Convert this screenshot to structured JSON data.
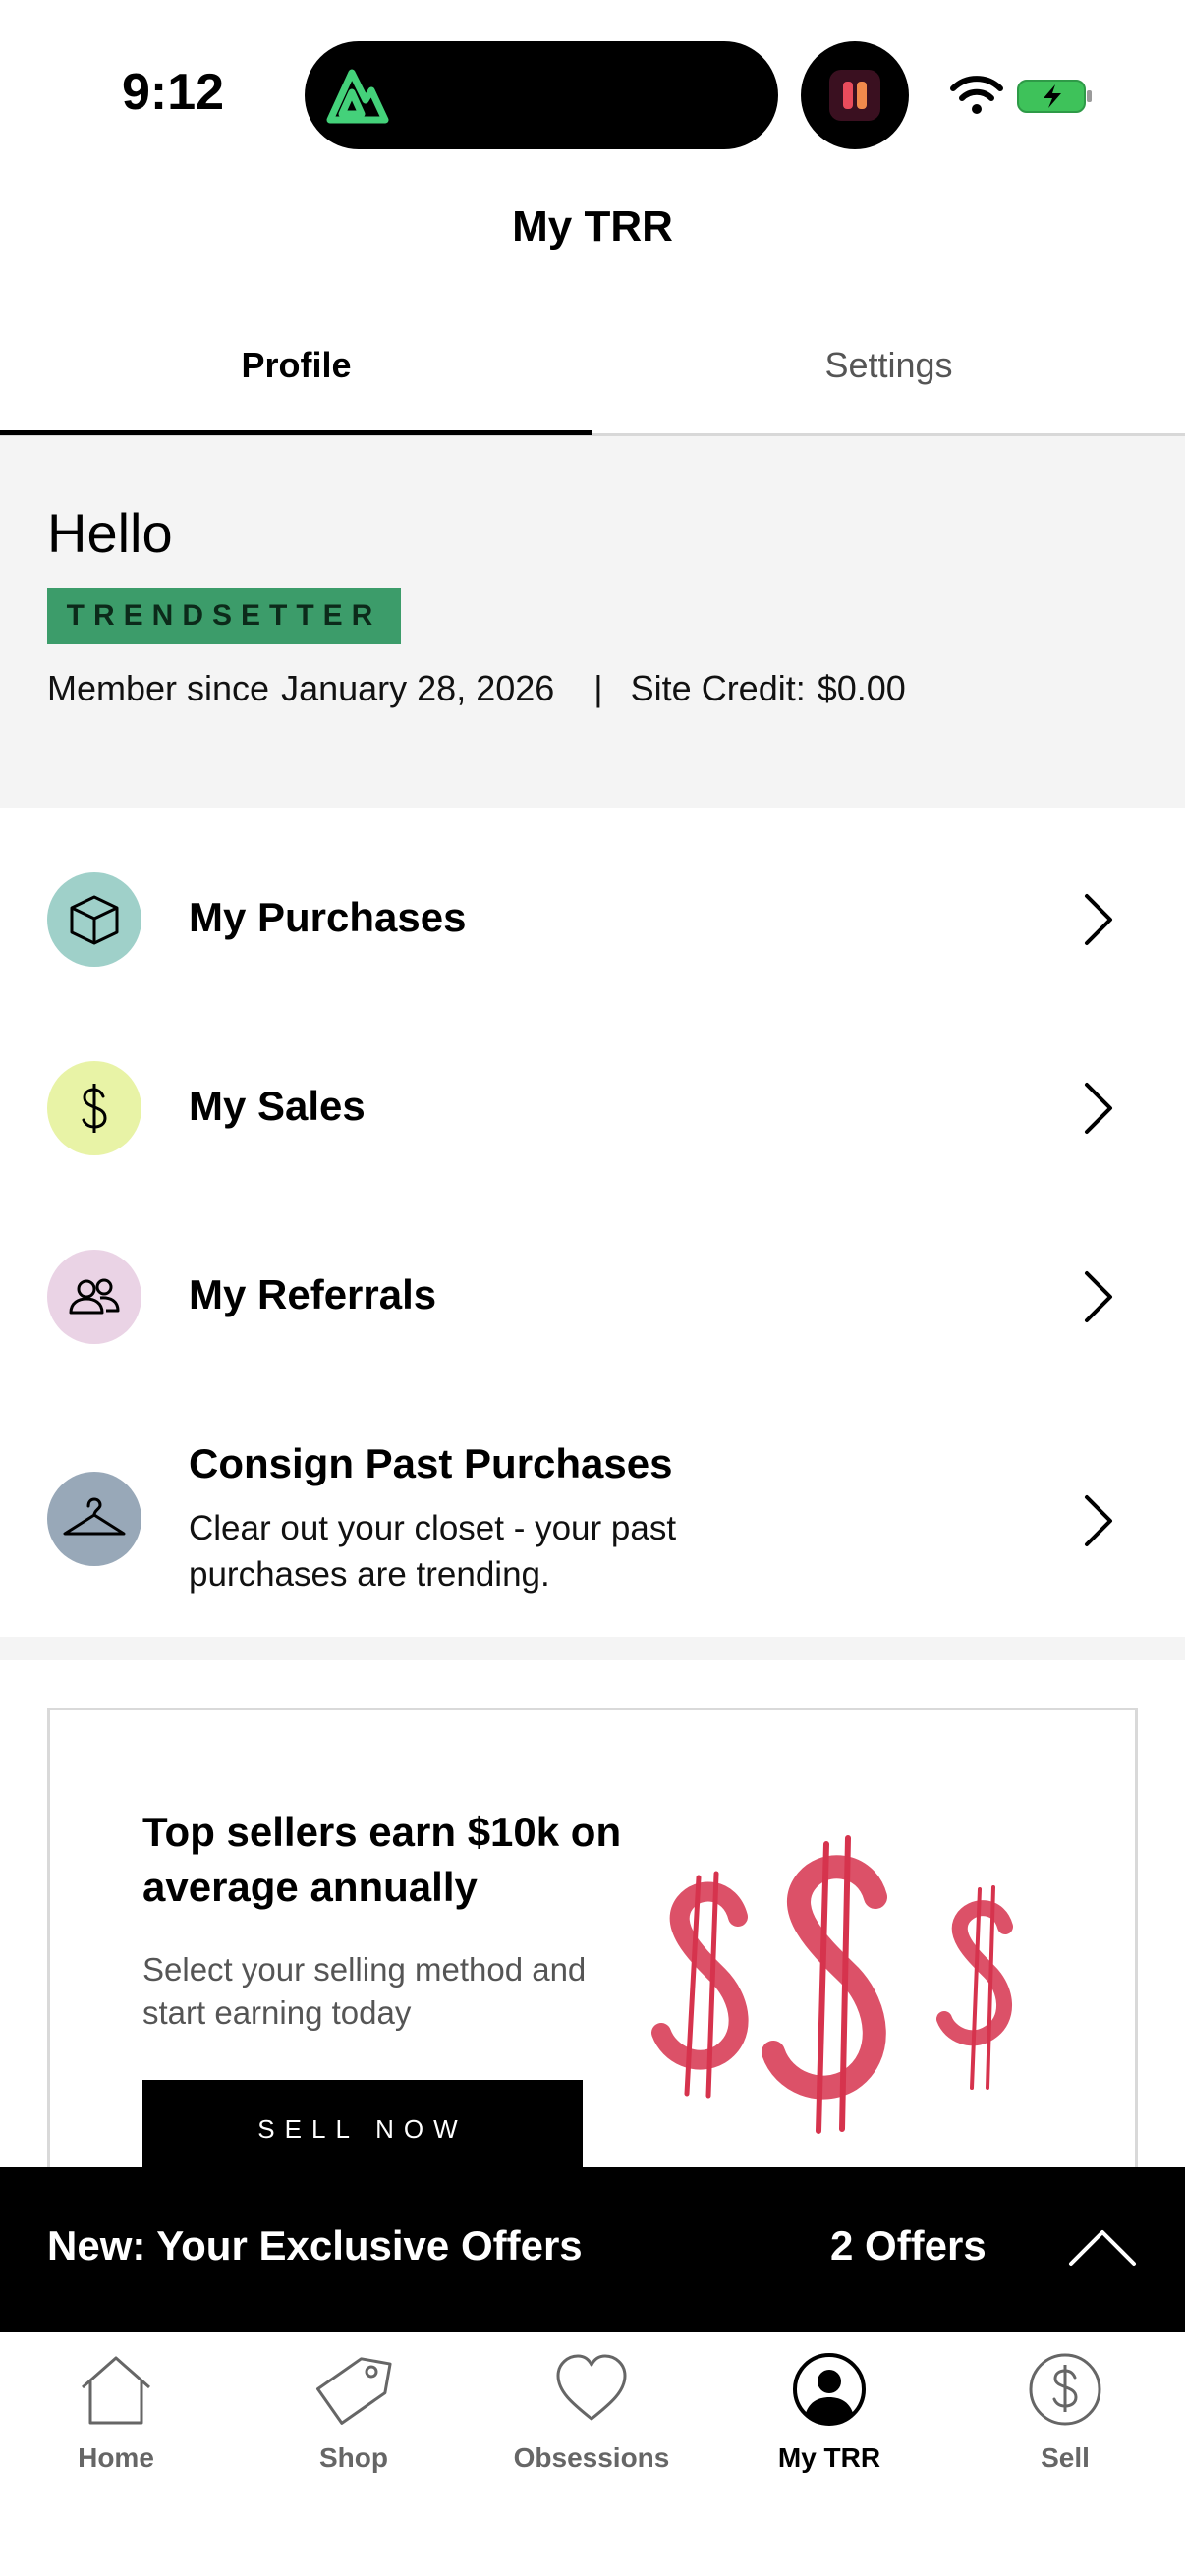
{
  "status_bar": {
    "time": "9:12"
  },
  "header": {
    "title": "My TRR"
  },
  "tabs": [
    {
      "label": "Profile",
      "active": true
    },
    {
      "label": "Settings",
      "active": false
    }
  ],
  "profile": {
    "greeting": "Hello",
    "tier": "TRENDSETTER",
    "tier_color": "#3c9c6a",
    "member_since_label": "Member since",
    "member_since_date": "January 28, 2026",
    "separator": "|",
    "site_credit_label": "Site Credit:",
    "site_credit_value": "$0.00"
  },
  "menu": [
    {
      "label": "My Purchases",
      "icon": "box-icon",
      "icon_bg": "#9fd0c9"
    },
    {
      "label": "My Sales",
      "icon": "dollar-icon",
      "icon_bg": "#e8f3a6"
    },
    {
      "label": "My Referrals",
      "icon": "people-icon",
      "icon_bg": "#ead3e5"
    },
    {
      "label": "Consign Past Purchases",
      "sub": "Clear out your closet - your past purchases are trending.",
      "icon": "hanger-icon",
      "icon_bg": "#98a8b8"
    }
  ],
  "promo": {
    "title": "Top sellers earn $10k on average annually",
    "subtitle": "Select your selling method and start earning today",
    "button": "SELL NOW"
  },
  "offers": {
    "title": "New: Your Exclusive Offers",
    "count": "2 Offers"
  },
  "bottom_nav": [
    {
      "label": "Home",
      "icon": "home-icon"
    },
    {
      "label": "Shop",
      "icon": "tag-icon"
    },
    {
      "label": "Obsessions",
      "icon": "heart-icon"
    },
    {
      "label": "My TRR",
      "icon": "profile-icon",
      "active": true
    },
    {
      "label": "Sell",
      "icon": "dollar-circle-icon"
    }
  ]
}
